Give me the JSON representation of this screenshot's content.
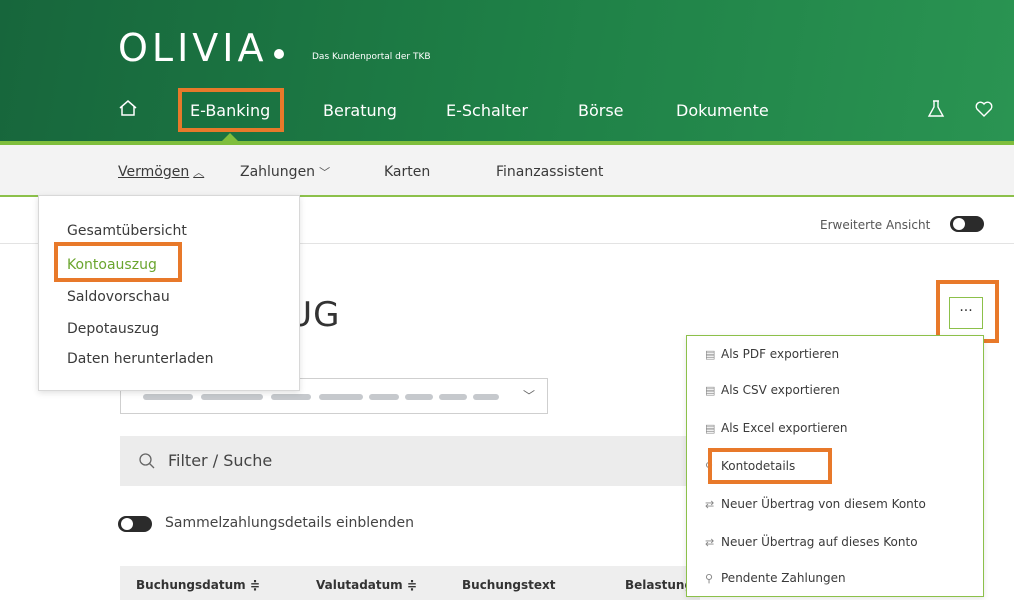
{
  "header": {
    "logo": "OLIVIA",
    "tagline": "Das Kundenportal der TKB",
    "nav": [
      {
        "label": "E-Banking"
      },
      {
        "label": "Beratung"
      },
      {
        "label": "E-Schalter"
      },
      {
        "label": "Börse"
      },
      {
        "label": "Dokumente"
      }
    ],
    "icons": [
      "home-icon",
      "flask-icon",
      "heart-icon"
    ]
  },
  "subnav": {
    "items": [
      {
        "label": "Vermögen",
        "chevron": "^"
      },
      {
        "label": "Zahlungen",
        "chevron": "v"
      },
      {
        "label": "Karten"
      },
      {
        "label": "Finanzassistent"
      }
    ]
  },
  "toolbar": {
    "erweiterte_ansicht": "Erweiterte Ansicht"
  },
  "page": {
    "title_visible": "ZUG",
    "more_button": "···"
  },
  "filter": {
    "placeholder": "Filter / Suche"
  },
  "sammel": {
    "label": "Sammelzahlungsdetails einblenden"
  },
  "table": {
    "headers": [
      "Buchungsdatum ≑",
      "Valutadatum ≑",
      "Buchungstext",
      "Belastung"
    ]
  },
  "dropdown_left": {
    "items": [
      "Gesamtübersicht",
      "Kontoauszug",
      "Saldovorschau",
      "Depotauszug",
      "Daten herunterladen"
    ]
  },
  "dropdown_right": {
    "items": [
      {
        "label": "Als PDF exportieren",
        "icon": "document-icon"
      },
      {
        "label": "Als CSV exportieren",
        "icon": "document-icon"
      },
      {
        "label": "Als Excel exportieren",
        "icon": "document-icon"
      },
      {
        "label": "Kontodetails",
        "icon": "search-icon"
      },
      {
        "label": "Neuer Übertrag von diesem Konto",
        "icon": "transfer-icon"
      },
      {
        "label": "Neuer Übertrag auf dieses Konto",
        "icon": "transfer-icon"
      },
      {
        "label": "Pendente Zahlungen",
        "icon": "search-icon"
      }
    ]
  },
  "colors": {
    "header_green": "#1e7f46",
    "accent_lime": "#7fbe3c",
    "highlight_orange": "#e8792a"
  }
}
